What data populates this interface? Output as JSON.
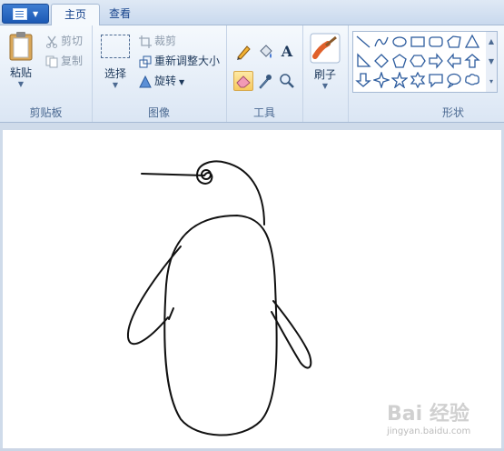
{
  "tabs": {
    "home": "主页",
    "view": "查看"
  },
  "clipboard": {
    "paste_label": "粘贴",
    "cut_label": "剪切",
    "copy_label": "复制",
    "group_label": "剪贴板"
  },
  "image": {
    "select_label": "选择",
    "crop_label": "裁剪",
    "resize_label": "重新调整大小",
    "rotate_label": "旋转",
    "group_label": "图像"
  },
  "tools": {
    "group_label": "工具",
    "text_glyph": "A"
  },
  "brushes": {
    "label": "刷子"
  },
  "shapes": {
    "group_label": "形状"
  },
  "watermark": {
    "brand": "Bai 经验",
    "sub": "jingyan.baidu.com"
  },
  "colors": {
    "accent": "#1c59b5",
    "ribbon": "#f5f9fd",
    "selected_tool": "#f7c95f"
  }
}
